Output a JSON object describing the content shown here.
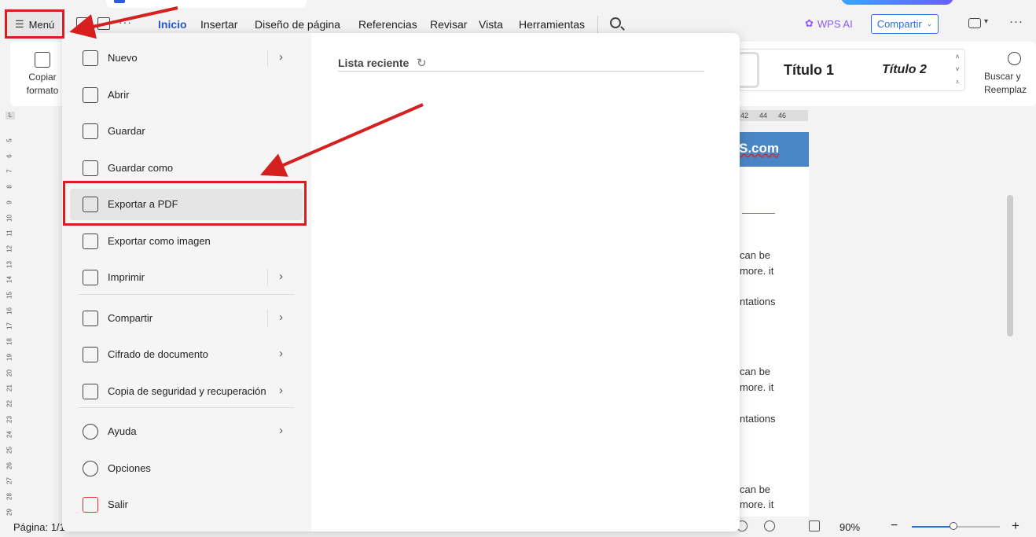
{
  "ribbon_tabs": [
    {
      "label": "Inicio",
      "active": true
    },
    {
      "label": "Insertar"
    },
    {
      "label": "Diseño de página"
    },
    {
      "label": "Referencias"
    },
    {
      "label": "Revisar"
    },
    {
      "label": "Vista"
    },
    {
      "label": "Herramientas"
    }
  ],
  "menu_button": {
    "label": "Menú",
    "icon": "hamburger-icon"
  },
  "wps_ai": "WPS AI",
  "share": "Compartir",
  "ribbon": {
    "copy_format_line1": "Copiar",
    "copy_format_line2": "formato",
    "style_title1": "Título 1",
    "style_title2": "Título 2",
    "find_line1": "Buscar y",
    "find_line2": "Reemplaz"
  },
  "menu": {
    "items": [
      {
        "label": "Nuevo",
        "icon": "new-file-icon",
        "submenu": true
      },
      {
        "label": "Abrir",
        "icon": "folder-open-icon",
        "submenu": false
      },
      {
        "label": "Guardar",
        "icon": "save-icon",
        "submenu": false
      },
      {
        "label": "Guardar como",
        "icon": "save-as-icon",
        "submenu": true
      },
      {
        "label": "Exportar a PDF",
        "icon": "export-pdf-icon",
        "submenu": false,
        "highlighted": true
      },
      {
        "label": "Exportar como imagen",
        "icon": "export-image-icon",
        "submenu": false
      },
      {
        "label": "Imprimir",
        "icon": "print-icon",
        "submenu": true
      },
      {
        "label": "Compartir",
        "icon": "share-icon",
        "submenu": true
      },
      {
        "label": "Cifrado de documento",
        "icon": "encrypt-document-icon",
        "submenu": true
      },
      {
        "label": "Copia de seguridad y recuperación",
        "icon": "backup-cloud-icon",
        "submenu": true
      },
      {
        "label": "Ayuda",
        "icon": "help-icon",
        "submenu": true
      },
      {
        "label": "Opciones",
        "icon": "options-icon",
        "submenu": false
      },
      {
        "label": "Salir",
        "icon": "exit-icon",
        "submenu": false
      }
    ],
    "recent_title": "Lista reciente"
  },
  "document": {
    "banner": "S.com",
    "text_lines": [
      "can  be",
      "more. it",
      "ntations",
      "can  be",
      "more. it",
      "ntations",
      "can  be",
      "more. it"
    ]
  },
  "ruler": {
    "horizontal_ticks": [
      "42",
      "44",
      "46"
    ],
    "vertical_ticks": [
      "5",
      "6",
      "7",
      "8",
      "9",
      "10",
      "11",
      "12",
      "13",
      "14",
      "15",
      "16",
      "17",
      "18",
      "19",
      "20",
      "21",
      "22",
      "23",
      "24",
      "25",
      "26",
      "27",
      "28",
      "29"
    ]
  },
  "status": {
    "page": "Página: 1/1",
    "zoom": "90%",
    "zoom_level_percent": 47
  },
  "colors": {
    "accent": "#2a58c8",
    "annotation_red": "#d62020",
    "banner_blue": "#4a86c5"
  }
}
